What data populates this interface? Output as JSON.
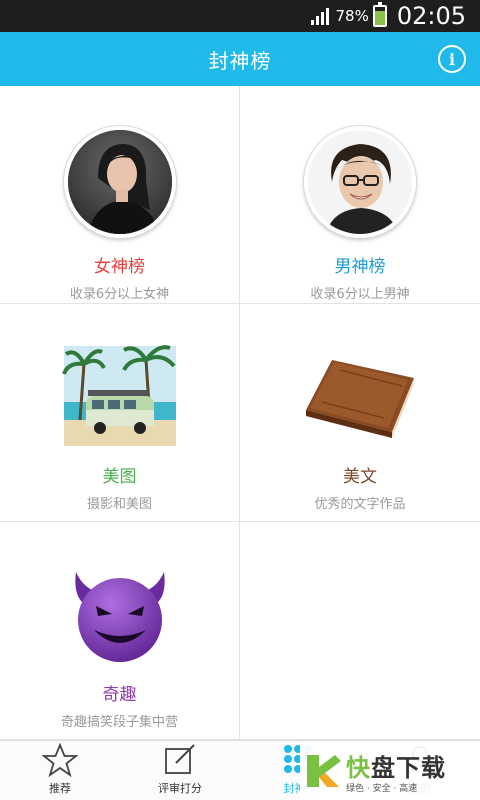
{
  "status_bar": {
    "battery": "78%",
    "time": "02:05"
  },
  "header": {
    "title": "封神榜",
    "info_icon": "info-icon"
  },
  "cells": [
    {
      "title": "女神榜",
      "subtitle": "收录6分以上女神",
      "title_color": "#e8413c",
      "icon": "woman-avatar"
    },
    {
      "title": "男神榜",
      "subtitle": "收录6分以上男神",
      "title_color": "#1f9ad6",
      "icon": "man-avatar"
    },
    {
      "title": "美图",
      "subtitle": "摄影和美图",
      "title_color": "#4caf50",
      "icon": "photo-thumbnail"
    },
    {
      "title": "美文",
      "subtitle": "优秀的文字作品",
      "title_color": "#7a4a2a",
      "icon": "book-icon"
    },
    {
      "title": "奇趣",
      "subtitle": "奇趣搞笑段子集中营",
      "title_color": "#8e3aa8",
      "icon": "devil-face-icon"
    }
  ],
  "bottom_nav": [
    {
      "label": "推荐",
      "icon": "star-icon"
    },
    {
      "label": "评审打分",
      "icon": "edit-icon"
    },
    {
      "label": "封神榜",
      "icon": "grid-dots-icon",
      "active": true
    },
    {
      "label": "我的",
      "icon": "person-icon"
    }
  ],
  "watermark": {
    "big_prefix": "快",
    "big_rest": "盘下载",
    "small": "绿色 · 安全 · 高速"
  }
}
